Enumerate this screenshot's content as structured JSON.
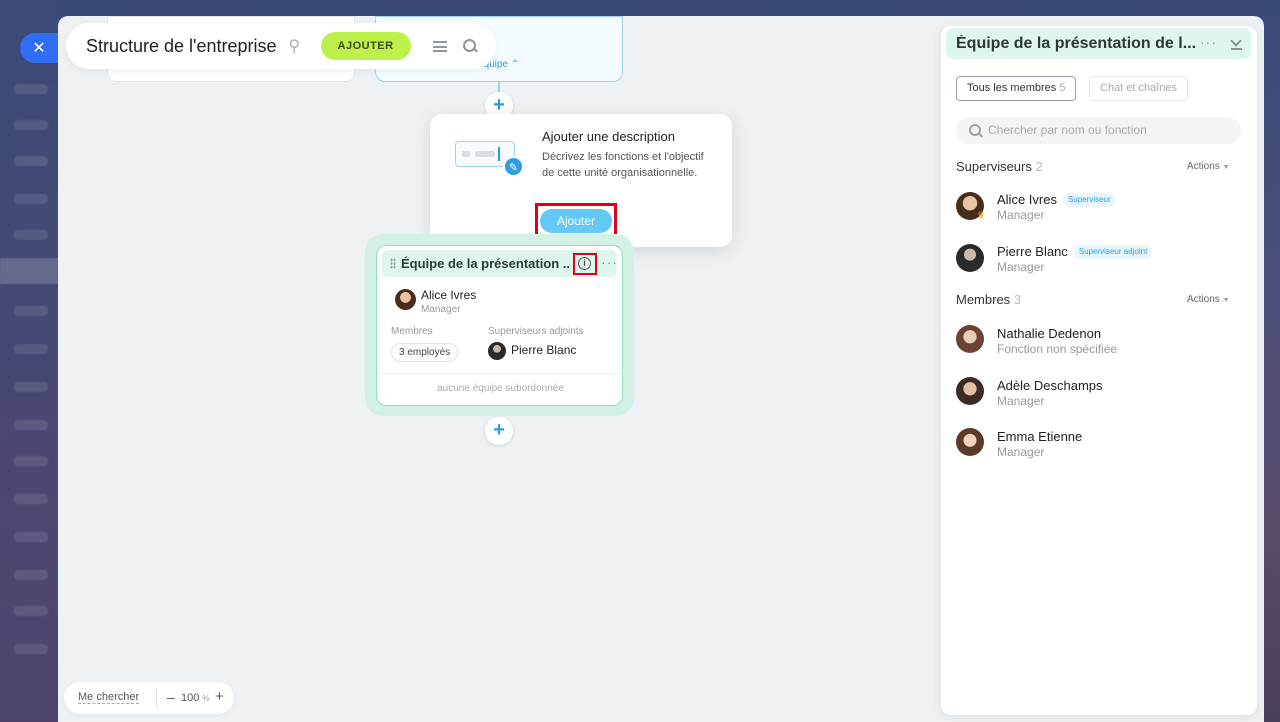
{
  "header": {
    "title": "Structure de l'entreprise",
    "add_label": "AJOUTER"
  },
  "canvas": {
    "team_toggle": "équipe"
  },
  "popup": {
    "title": "Ajouter une description",
    "description": "Décrivez les fonctions et l'objectif de cette unité organisationnelle.",
    "button": "Ajouter"
  },
  "card": {
    "title": "Équipe de la présentation ...",
    "manager_name": "Alice Ivres",
    "manager_role": "Manager",
    "members_label": "Membres",
    "members_count": "3 employés",
    "deputies_label": "Superviseurs adjoints",
    "deputy_name": "Pierre Blanc",
    "footer": "aucune équipe subordonnée"
  },
  "zoom": {
    "find_me": "Me chercher",
    "minus": "–",
    "value": "100",
    "unit": "%",
    "plus": "+"
  },
  "panel": {
    "title": "Équipe de la présentation de l...",
    "tabs": [
      {
        "label": "Tous les membres",
        "count": "5"
      },
      {
        "label": "Chat et chaînes"
      }
    ],
    "search_placeholder": "Chercher par nom ou fonction",
    "supervisors": {
      "title": "Superviseurs",
      "count": "2",
      "actions": "Actions",
      "people": [
        {
          "name": "Alice Ivres",
          "tag": "Superviseur",
          "role": "Manager"
        },
        {
          "name": "Pierre Blanc",
          "tag": "Superviseur adjoint",
          "role": "Manager"
        }
      ]
    },
    "members": {
      "title": "Membres",
      "count": "3",
      "actions": "Actions",
      "people": [
        {
          "name": "Nathalie Dedenon",
          "role": "Fonction non spécifiée"
        },
        {
          "name": "Adèle Deschamps",
          "role": "Manager"
        },
        {
          "name": "Emma Etienne",
          "role": "Manager"
        }
      ]
    }
  },
  "colors": {
    "accent_green": "#bdf04a",
    "accent_blue": "#2a9ee0",
    "highlight_red": "#e0001b",
    "team_header": "#dff6ec"
  }
}
